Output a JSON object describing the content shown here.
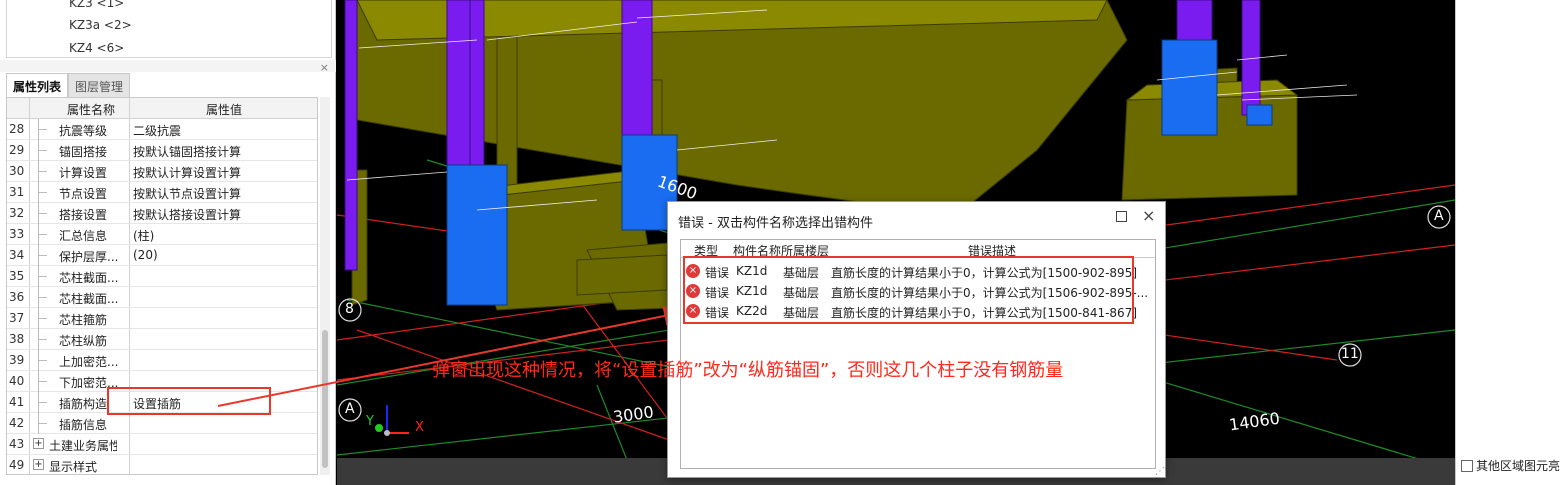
{
  "tree": {
    "items": [
      "KZ3 <1>",
      "KZ3a <2>",
      "KZ4 <6>"
    ]
  },
  "panel": {
    "close_glyph": "×",
    "tabs": [
      {
        "label": "属性列表",
        "active": true
      },
      {
        "label": "图层管理",
        "active": false
      }
    ],
    "headers": {
      "name": "属性名称",
      "value": "属性值"
    },
    "rows": [
      {
        "num": "28",
        "name": "抗震等级",
        "value": "二级抗震"
      },
      {
        "num": "29",
        "name": "锚固搭接",
        "value": "按默认锚固搭接计算"
      },
      {
        "num": "30",
        "name": "计算设置",
        "value": "按默认计算设置计算"
      },
      {
        "num": "31",
        "name": "节点设置",
        "value": "按默认节点设置计算"
      },
      {
        "num": "32",
        "name": "搭接设置",
        "value": "按默认搭接设置计算"
      },
      {
        "num": "33",
        "name": "汇总信息",
        "value": "(柱)"
      },
      {
        "num": "34",
        "name": "保护层厚...",
        "value": "(20)"
      },
      {
        "num": "35",
        "name": "芯柱截面...",
        "value": ""
      },
      {
        "num": "36",
        "name": "芯柱截面...",
        "value": ""
      },
      {
        "num": "37",
        "name": "芯柱箍筋",
        "value": ""
      },
      {
        "num": "38",
        "name": "芯柱纵筋",
        "value": ""
      },
      {
        "num": "39",
        "name": "上加密范...",
        "value": ""
      },
      {
        "num": "40",
        "name": "下加密范...",
        "value": ""
      },
      {
        "num": "41",
        "name": "插筋构造",
        "value": "设置插筋"
      },
      {
        "num": "42",
        "name": "插筋信息",
        "value": ""
      },
      {
        "num": "43",
        "name": "土建业务属性",
        "value": "",
        "group": true
      },
      {
        "num": "49",
        "name": "显示样式",
        "value": "",
        "group": true
      }
    ],
    "expander_glyph": "+"
  },
  "viewport": {
    "dims": [
      "1600",
      "3000",
      "14060"
    ],
    "axis_labels": [
      "A",
      "A",
      "8",
      "8",
      "11"
    ],
    "axes": [
      "Y",
      "X"
    ]
  },
  "error_dialog": {
    "title": "错误 - 双击构件名称选择出错构件",
    "close_glyph": "×",
    "columns": {
      "type": "类型",
      "name": "构件名称",
      "floor": "所属楼层",
      "desc": "错误描述"
    },
    "rows": [
      {
        "type": "错误",
        "name": "KZ1d",
        "floor": "基础层",
        "desc": "直筋长度的计算结果小于0，计算公式为[1500-902-895]"
      },
      {
        "type": "错误",
        "name": "KZ1d",
        "floor": "基础层",
        "desc": "直筋长度的计算结果小于0，计算公式为[1506-902-895-..."
      },
      {
        "type": "错误",
        "name": "KZ2d",
        "floor": "基础层",
        "desc": "直筋长度的计算结果小于0，计算公式为[1500-841-867]"
      }
    ],
    "icon_glyph": "×",
    "grip_glyph": "⋰"
  },
  "annotation": {
    "text": "弹窗出现这种情况，将“设置插筋”改为“纵筋锚固”，否则这几个柱子没有钢筋量"
  },
  "right_panel": {
    "checkbox_label": "其他区域图元亮"
  },
  "colors": {
    "annotation": "#ff2a1a",
    "column_purple": "#7a1cf0",
    "column_blue": "#1a6df0",
    "beam_olive": "#6b6a00",
    "grid_green": "#1f8a2a",
    "grid_red": "#d02020",
    "error_icon": "#e0393a"
  }
}
